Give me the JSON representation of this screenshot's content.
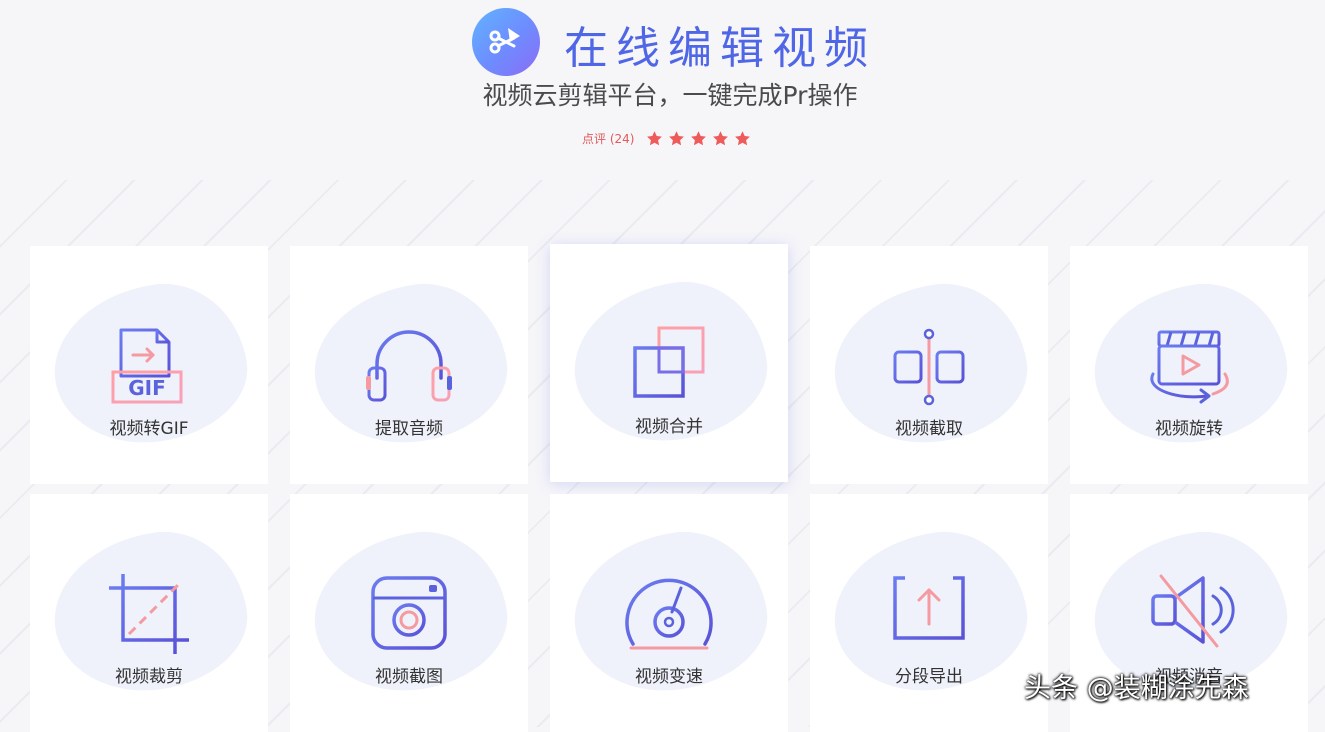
{
  "header": {
    "title": "在线编辑视频",
    "subtitle": "视频云剪辑平台，一键完成Pr操作",
    "rating_label": "点评 (24)",
    "stars": 5,
    "accent_color": "#4f66e6",
    "star_color": "#ef5a5a"
  },
  "tools": [
    {
      "label": "视频转GIF",
      "icon": "gif-file-icon"
    },
    {
      "label": "提取音频",
      "icon": "headphones-icon"
    },
    {
      "label": "视频合并",
      "icon": "merge-squares-icon"
    },
    {
      "label": "视频截取",
      "icon": "split-cut-icon"
    },
    {
      "label": "视频旋转",
      "icon": "clapperboard-rotate-icon"
    },
    {
      "label": "视频裁剪",
      "icon": "crop-icon"
    },
    {
      "label": "视频截图",
      "icon": "camera-icon"
    },
    {
      "label": "视频变速",
      "icon": "speedometer-icon"
    },
    {
      "label": "分段导出",
      "icon": "upload-screen-icon"
    },
    {
      "label": "视频消音",
      "icon": "mute-speaker-icon"
    }
  ],
  "watermark": "头条 @装糊涂先森"
}
